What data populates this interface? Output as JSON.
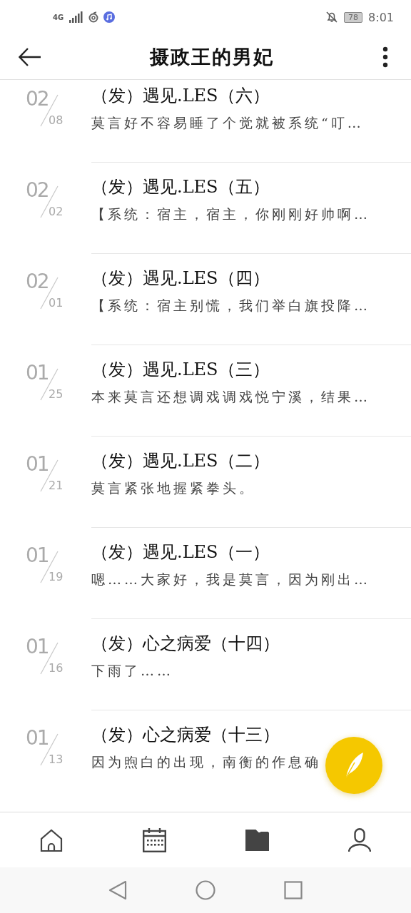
{
  "status_bar": {
    "network": "4G",
    "battery": "78",
    "time": "8:01"
  },
  "app_bar": {
    "title": "摄政王的男妃"
  },
  "chapters": [
    {
      "month": "02",
      "day": "08",
      "title": "（发）遇见.LES（六）",
      "excerpt": "莫言好不容易睡了个觉就被系统“叮…"
    },
    {
      "month": "02",
      "day": "02",
      "title": "（发）遇见.LES（五）",
      "excerpt": "【系统：宿主，宿主，你刚刚好帅啊…"
    },
    {
      "month": "02",
      "day": "01",
      "title": "（发）遇见.LES（四）",
      "excerpt": "【系统：宿主别慌，我们举白旗投降…"
    },
    {
      "month": "01",
      "day": "25",
      "title": "（发）遇见.LES（三）",
      "excerpt": "本来莫言还想调戏调戏悦宁溪，结果…"
    },
    {
      "month": "01",
      "day": "21",
      "title": "（发）遇见.LES（二）",
      "excerpt": "莫言紧张地握紧拳头。"
    },
    {
      "month": "01",
      "day": "19",
      "title": "（发）遇见.LES（一）",
      "excerpt": "嗯……大家好，我是莫言，因为刚出…"
    },
    {
      "month": "01",
      "day": "16",
      "title": "（发）心之病爱（十四）",
      "excerpt": "下雨了……"
    },
    {
      "month": "01",
      "day": "13",
      "title": "（发）心之病爱（十三）",
      "excerpt": "因为煦白的出现，南衡的作息确"
    }
  ],
  "bottom_nav": [
    {
      "selected": false
    },
    {
      "selected": false
    },
    {
      "selected": true
    },
    {
      "selected": false
    }
  ]
}
